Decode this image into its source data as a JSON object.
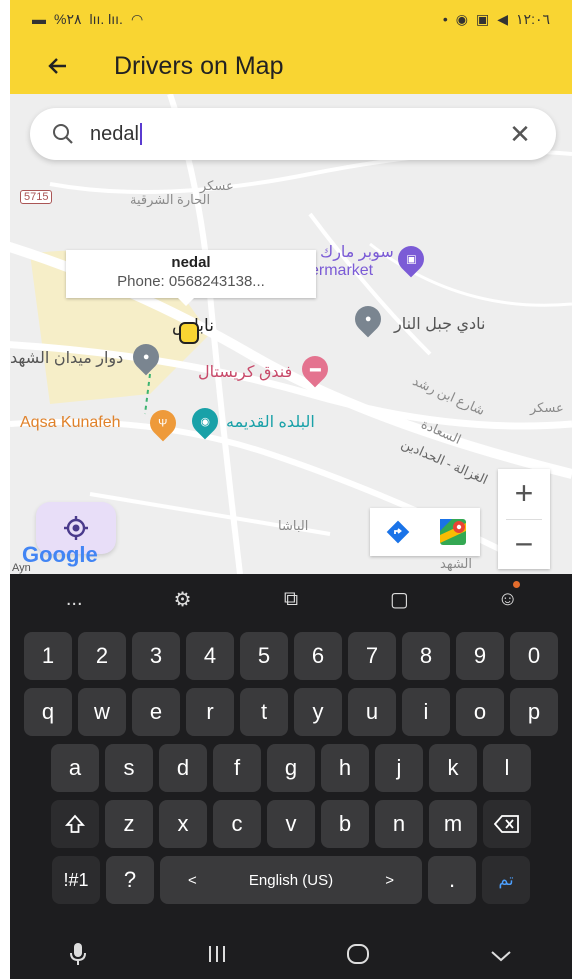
{
  "status_bar": {
    "battery_text": "%٢٨",
    "signal_text": "lıı. lıı.",
    "time": "١٢:٠٦"
  },
  "app_bar": {
    "title": "Drivers on Map"
  },
  "search": {
    "value": "nedal"
  },
  "info_window": {
    "name": "nedal",
    "phone": "Phone: 0568243138..."
  },
  "map_labels": {
    "road_5715": "5715",
    "hara_sharqia": "الحارة الشرقية",
    "askar_top": "عسكر",
    "supermarket_ar": "سوبر مارك",
    "supermarket_en": "ermarket",
    "nablus": "نابلس",
    "jabal_nar": "نادي جبل النار",
    "midan_shuhada": "دوار ميدان الشهد",
    "crystal_hotel": "فندق كريستال",
    "aqsa_kunafeh": "Aqsa Kunafeh",
    "old_town": "البلده القديمه",
    "ghazala": "الغزالة - الحدادين",
    "saada": "السعادة",
    "ibn_rushd": "شارع ابن رشد",
    "askar_right": "عسكر",
    "basha": "الباشا",
    "shuhada": "الشهد",
    "google": "Google",
    "ayn": "Ayn"
  },
  "keyboard": {
    "number_row": [
      "1",
      "2",
      "3",
      "4",
      "5",
      "6",
      "7",
      "8",
      "9",
      "0"
    ],
    "row1": [
      "q",
      "w",
      "e",
      "r",
      "t",
      "y",
      "u",
      "i",
      "o",
      "p"
    ],
    "row2": [
      "a",
      "s",
      "d",
      "f",
      "g",
      "h",
      "j",
      "k",
      "l"
    ],
    "row3": [
      "z",
      "x",
      "c",
      "v",
      "b",
      "n",
      "m"
    ],
    "symbols_key": "!#1",
    "question_key": "?",
    "space_label": "English (US)",
    "space_left": "<",
    "space_right": ">",
    "period_key": ".",
    "done_key": "تم",
    "more_key": "..."
  },
  "colors": {
    "brand_yellow": "#F9D532",
    "keyboard_bg": "#1D1D1F",
    "locate_bg": "#E8DEF8"
  }
}
